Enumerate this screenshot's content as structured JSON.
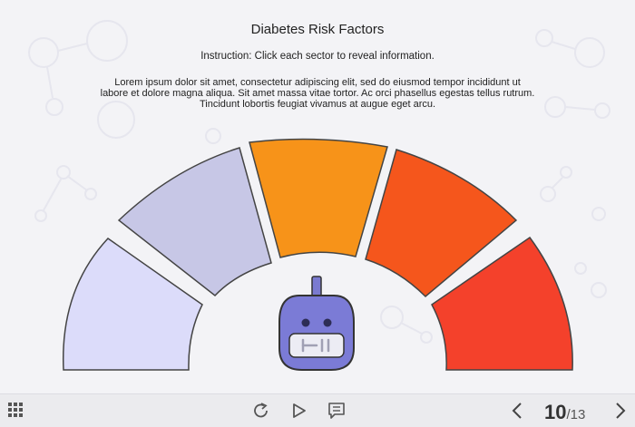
{
  "header": {
    "title": "Diabetes Risk Factors",
    "instruction": "Instruction: Click each sector to reveal information.",
    "body": "Lorem ipsum dolor sit amet, consectetur adipiscing elit, sed do eiusmod tempor incididunt ut labore et dolore magna aliqua. Sit amet massa vitae tortor. Ac orci phasellus egestas tellus rutrum. Tincidunt lobortis feugiat vivamus at augue eget arcu."
  },
  "gauge": {
    "sectors": [
      {
        "color": "#dcdcfa"
      },
      {
        "color": "#c7c7e6"
      },
      {
        "color": "#f79319"
      },
      {
        "color": "#f5561c"
      },
      {
        "color": "#f4412b"
      }
    ],
    "center_icon": "glucose-meter-icon"
  },
  "footer": {
    "menu_icon": "grid-menu-icon",
    "replay_icon": "replay-icon",
    "play_icon": "play-icon",
    "notes_icon": "notes-icon",
    "prev_icon": "chevron-left-icon",
    "next_icon": "chevron-right-icon",
    "current_page": "10",
    "total_pages": "/13"
  }
}
